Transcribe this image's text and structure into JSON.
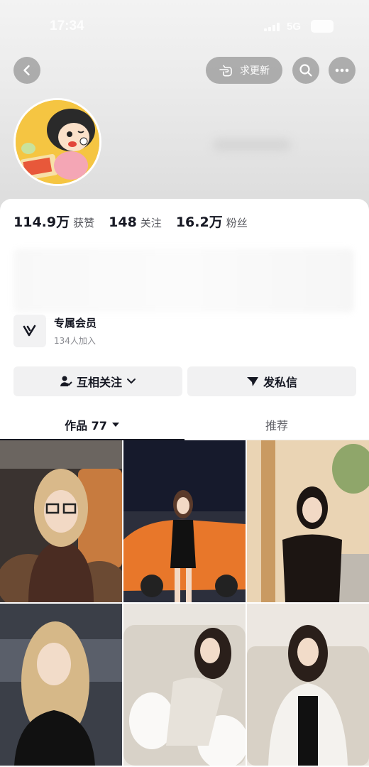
{
  "status": {
    "time": "17:34",
    "network": "5G",
    "battery": "46"
  },
  "header": {
    "update_request_label": "求更新"
  },
  "stats": [
    {
      "value": "114.9万",
      "label": "获赞"
    },
    {
      "value": "148",
      "label": "关注"
    },
    {
      "value": "16.2万",
      "label": "粉丝"
    }
  ],
  "member": {
    "title": "专属会员",
    "subtitle": "134人加入"
  },
  "actions": {
    "follow_label": "互相关注",
    "dm_label": "发私信"
  },
  "tabs": {
    "works_label": "作品 77",
    "recommend_label": "推荐"
  },
  "colors": {
    "accent": "#161823",
    "button_bg": "#f1f1f2",
    "muted": "#8a8b91"
  }
}
